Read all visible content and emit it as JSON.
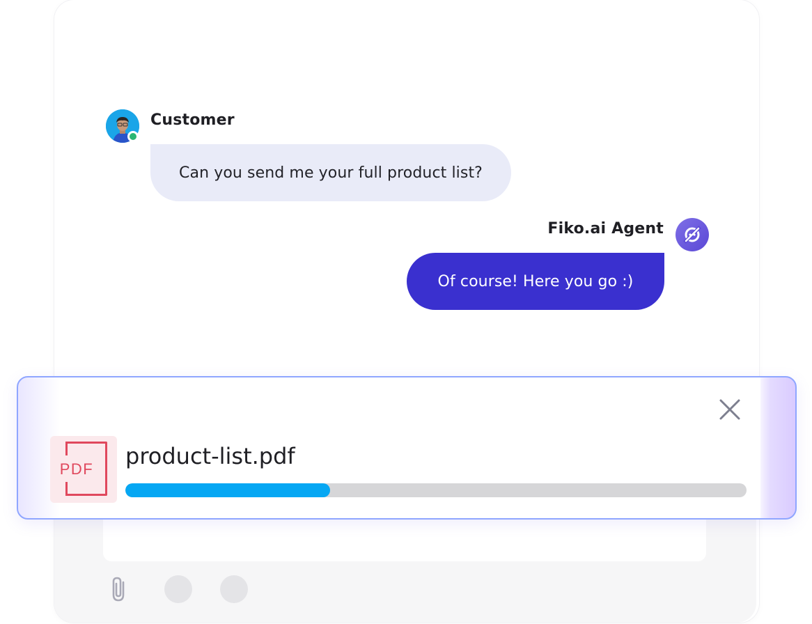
{
  "messages": [
    {
      "sender": "Customer",
      "text": "Can you send me your full product list?"
    },
    {
      "sender": "Fiko.ai Agent",
      "text": "Of course! Here you go :)"
    }
  ],
  "upload": {
    "file_name": "product-list.pdf",
    "file_type_label": "PDF",
    "file_icon": "pdf-file-icon",
    "close_icon": "close-icon",
    "progress_fraction": 0.33,
    "progress_color": "#06a7f3"
  },
  "composer": {
    "attach_icon": "paperclip-icon"
  },
  "colors": {
    "customer_bubble": "#e9ebf8",
    "agent_bubble": "#3a30cf",
    "online_status": "#2bb673",
    "pdf_accent": "#e0485d"
  }
}
